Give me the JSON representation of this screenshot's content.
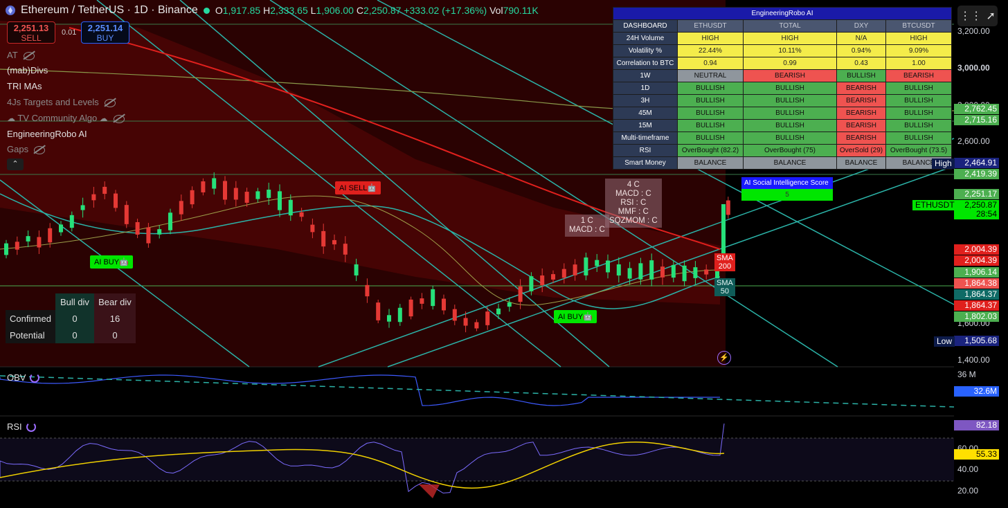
{
  "header": {
    "symbol": "Ethereum / TetherUS · 1D · Binance",
    "open_label": "O",
    "open": "1,917.85",
    "high_label": "H",
    "high": "2,333.65",
    "low_label": "L",
    "low": "1,906.00",
    "close_label": "C",
    "close": "2,250.87",
    "change": "+333.02 (+17.36%)",
    "vol_label": "Vol",
    "vol": "790.11K"
  },
  "trade": {
    "sell_price": "2,251.13",
    "sell_label": "SELL",
    "spread": "0.01",
    "buy_price": "2,251.14",
    "buy_label": "BUY"
  },
  "indicators": [
    {
      "label": "AT",
      "hidden": true
    },
    {
      "label": "(mab)Divs",
      "hidden": false
    },
    {
      "label": "TRI MAs",
      "hidden": false
    },
    {
      "label": "4Js Targets and Levels",
      "hidden": true
    },
    {
      "label": "TV Community Algo",
      "hidden": true
    },
    {
      "label": "EngineeringRobo AI",
      "hidden": false
    },
    {
      "label": "Gaps",
      "hidden": true
    }
  ],
  "collapse_symbol": "⌃",
  "dashboard": {
    "title": "EngineeringRobo AI",
    "headers": [
      "DASHBOARD",
      "ETHUSDT",
      "TOTAL",
      "DXY",
      "BTCUSDT"
    ],
    "rows": [
      {
        "label": "24H Volume",
        "cells": [
          {
            "t": "HIGH",
            "c": "yel"
          },
          {
            "t": "HIGH",
            "c": "yel"
          },
          {
            "t": "N/A",
            "c": "yel"
          },
          {
            "t": "HIGH",
            "c": "yel"
          }
        ]
      },
      {
        "label": "Volatility %",
        "cells": [
          {
            "t": "22.44%",
            "c": "yel"
          },
          {
            "t": "10.11%",
            "c": "yel"
          },
          {
            "t": "0.94%",
            "c": "yel"
          },
          {
            "t": "9.09%",
            "c": "yel"
          }
        ]
      },
      {
        "label": "Correlation to BTC",
        "cells": [
          {
            "t": "0.94",
            "c": "yel"
          },
          {
            "t": "0.99",
            "c": "yel"
          },
          {
            "t": "0.43",
            "c": "yel"
          },
          {
            "t": "1.00",
            "c": "yel"
          }
        ]
      },
      {
        "label": "1W",
        "cells": [
          {
            "t": "NEUTRAL",
            "c": "gry"
          },
          {
            "t": "BEARISH",
            "c": "red"
          },
          {
            "t": "BULLISH",
            "c": "grn"
          },
          {
            "t": "BEARISH",
            "c": "red"
          }
        ]
      },
      {
        "label": "1D",
        "cells": [
          {
            "t": "BULLISH",
            "c": "grn"
          },
          {
            "t": "BULLISH",
            "c": "grn"
          },
          {
            "t": "BEARISH",
            "c": "red"
          },
          {
            "t": "BULLISH",
            "c": "grn"
          }
        ]
      },
      {
        "label": "3H",
        "cells": [
          {
            "t": "BULLISH",
            "c": "grn"
          },
          {
            "t": "BULLISH",
            "c": "grn"
          },
          {
            "t": "BEARISH",
            "c": "red"
          },
          {
            "t": "BULLISH",
            "c": "grn"
          }
        ]
      },
      {
        "label": "45M",
        "cells": [
          {
            "t": "BULLISH",
            "c": "grn"
          },
          {
            "t": "BULLISH",
            "c": "grn"
          },
          {
            "t": "BEARISH",
            "c": "red"
          },
          {
            "t": "BULLISH",
            "c": "grn"
          }
        ]
      },
      {
        "label": "15M",
        "cells": [
          {
            "t": "BULLISH",
            "c": "grn"
          },
          {
            "t": "BULLISH",
            "c": "grn"
          },
          {
            "t": "BEARISH",
            "c": "red"
          },
          {
            "t": "BULLISH",
            "c": "grn"
          }
        ]
      },
      {
        "label": "Multi-timeframe",
        "cells": [
          {
            "t": "BULLISH",
            "c": "grn"
          },
          {
            "t": "BULLISH",
            "c": "grn"
          },
          {
            "t": "BEARISH",
            "c": "red"
          },
          {
            "t": "BULLISH",
            "c": "grn"
          }
        ]
      },
      {
        "label": "RSI",
        "cells": [
          {
            "t": "OverBought (82.2)",
            "c": "grn"
          },
          {
            "t": "OverBought (75)",
            "c": "grn"
          },
          {
            "t": "OverSold (29)",
            "c": "red"
          },
          {
            "t": "OverBought (73.5)",
            "c": "grn"
          }
        ]
      },
      {
        "label": "Smart Money",
        "cells": [
          {
            "t": "BALANCE",
            "c": "gry"
          },
          {
            "t": "BALANCE",
            "c": "gry"
          },
          {
            "t": "BALANCE",
            "c": "gry"
          },
          {
            "t": "BALANCE",
            "c": "gry"
          }
        ]
      }
    ]
  },
  "ai_score": {
    "title": "AI Social Intelligence Score",
    "value": "5"
  },
  "signals": {
    "buy1": "AI BUY🤖",
    "sell1": "AI SELL🤖",
    "buy2": "AI BUY🤖",
    "box1": [
      "1 C",
      "MACD : C"
    ],
    "box2": [
      "4 C",
      "MACD : C",
      "RSI : C",
      "MMF : C",
      "SQZMOM : C"
    ]
  },
  "sma": {
    "sma200": [
      "SMA",
      "200"
    ],
    "sma50": [
      "SMA",
      "50"
    ]
  },
  "divergence": {
    "headers": [
      "Bull div",
      "Bear div"
    ],
    "rows": [
      {
        "label": "Confirmed",
        "bull": "0",
        "bear": "16"
      },
      {
        "label": "Potential",
        "bull": "0",
        "bear": "0"
      }
    ]
  },
  "price_axis": {
    "ticks": [
      "3,200.00",
      "3,000.00",
      "2,800.00",
      "2,600.00",
      "1,600.00",
      "1,400.00"
    ],
    "tags": [
      {
        "v": "2,762.45",
        "bg": "#4caf50"
      },
      {
        "v": "2,715.16",
        "bg": "#4caf50"
      },
      {
        "v": "2,464.91",
        "bg": "#1a237e"
      },
      {
        "v": "2,419.39",
        "bg": "#4caf50"
      },
      {
        "v": "2,251.17",
        "bg": "#4caf50"
      },
      {
        "v": "2,250.87",
        "bg": "#00e600"
      },
      {
        "v": "28:54",
        "bg": "#00e600"
      },
      {
        "v": "2,004.39",
        "bg": "#e0201d"
      },
      {
        "v": "2,004.39",
        "bg": "#e0201d"
      },
      {
        "v": "1,906.14",
        "bg": "#4caf50"
      },
      {
        "v": "1,864.38",
        "bg": "#ef5350"
      },
      {
        "v": "1,864.37",
        "bg": "#0f6b66"
      },
      {
        "v": "1,864.37",
        "bg": "#e0201d"
      },
      {
        "v": "1,802.03",
        "bg": "#4caf50"
      },
      {
        "v": "1,505.68",
        "bg": "#1a237e"
      }
    ],
    "high_label": "High",
    "low_label": "Low",
    "symbol_tag": "ETHUSDT"
  },
  "obv": {
    "label": "OBV",
    "scale_top": "36 M",
    "value": "32.6M"
  },
  "rsi": {
    "label": "RSI",
    "value": "82.18",
    "ma_value": "55.33",
    "ticks": [
      "60.00",
      "40.00",
      "20.00"
    ]
  },
  "colors": {
    "bull": "#4caf50",
    "bear": "#ef5350",
    "up_candle": "#26e07a",
    "down_candle": "#e53935",
    "teal": "#2bb3a8",
    "purple": "#9c6cff"
  }
}
